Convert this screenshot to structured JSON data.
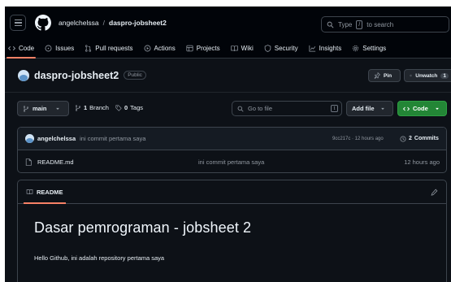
{
  "header": {
    "owner": "angelchelssa",
    "separator": "/",
    "repo": "daspro-jobsheet2",
    "search_prefix": "Type",
    "search_key": "/",
    "search_suffix": "to search"
  },
  "nav": {
    "tabs": [
      {
        "label": "Code",
        "icon": "code-icon"
      },
      {
        "label": "Issues",
        "icon": "issue-icon"
      },
      {
        "label": "Pull requests",
        "icon": "pull-request-icon"
      },
      {
        "label": "Actions",
        "icon": "play-icon"
      },
      {
        "label": "Projects",
        "icon": "table-icon"
      },
      {
        "label": "Wiki",
        "icon": "book-icon"
      },
      {
        "label": "Security",
        "icon": "shield-icon"
      },
      {
        "label": "Insights",
        "icon": "graph-icon"
      },
      {
        "label": "Settings",
        "icon": "gear-icon"
      }
    ]
  },
  "repo": {
    "name": "daspro-jobsheet2",
    "visibility": "Public",
    "pin_label": "Pin",
    "unwatch_label": "Unwatch",
    "unwatch_count": "1"
  },
  "toolbar": {
    "branch": "main",
    "branch_count": "1",
    "branch_word": "Branch",
    "tag_count": "0",
    "tag_word": "Tags",
    "goto_placeholder": "Go to file",
    "goto_key": "t",
    "add_file_label": "Add file",
    "code_label": "Code"
  },
  "latest_commit": {
    "author": "angelchelssa",
    "message": "ini commit pertama saya",
    "meta": "9cc217c · 12 hours ago",
    "commit_count": "2",
    "commit_word": "Commits"
  },
  "files": [
    {
      "name": "README.md",
      "commit": "ini commit pertama saya",
      "age": "12 hours ago"
    }
  ],
  "readme": {
    "tab_label": "README",
    "title": "Dasar pemrograman - jobsheet 2",
    "body": "Hello Github, ini adalah repository pertama saya"
  },
  "colors": {
    "background": "#0d1117",
    "header_bg": "#010409",
    "accent_underline": "#f78166",
    "code_button": "#238636"
  }
}
